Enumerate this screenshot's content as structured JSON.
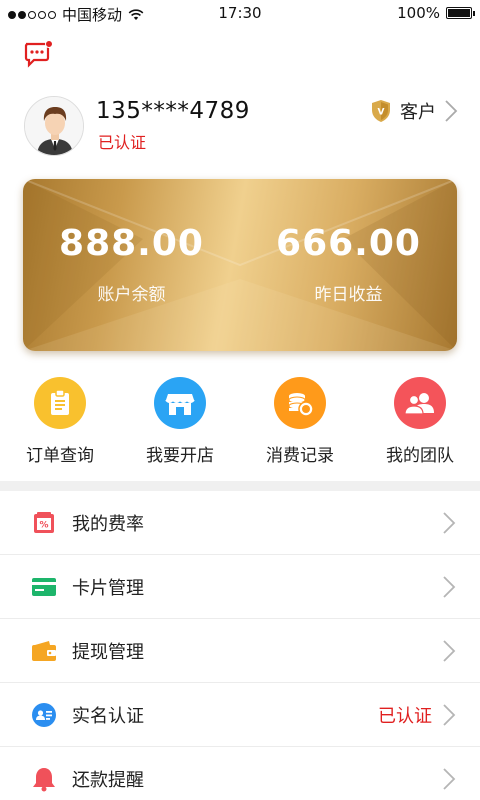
{
  "status_bar": {
    "carrier": "中国移动",
    "time": "17:30",
    "battery": "100%",
    "signal_bars": 2,
    "signal_total": 5
  },
  "profile": {
    "phone": "135****4789",
    "verified": "已认证",
    "customer_label": "客户",
    "badge_letter": "V"
  },
  "card": {
    "balance_value": "888.00",
    "balance_label": "账户余额",
    "yesterday_value": "666.00",
    "yesterday_label": "昨日收益"
  },
  "actions": [
    {
      "label": "订单查询",
      "icon": "order-icon",
      "color": "#f9c12e"
    },
    {
      "label": "我要开店",
      "icon": "shop-icon",
      "color": "#2aa4f4"
    },
    {
      "label": "消费记录",
      "icon": "coins-icon",
      "color": "#ff9a1a"
    },
    {
      "label": "我的团队",
      "icon": "team-icon",
      "color": "#f4545a"
    }
  ],
  "menu": [
    {
      "label": "我的费率",
      "icon": "rate-icon",
      "status": ""
    },
    {
      "label": "卡片管理",
      "icon": "card-icon",
      "status": ""
    },
    {
      "label": "提现管理",
      "icon": "wallet-icon",
      "status": ""
    },
    {
      "label": "实名认证",
      "icon": "id-icon",
      "status": "已认证"
    },
    {
      "label": "还款提醒",
      "icon": "bell-icon",
      "status": ""
    }
  ],
  "colors": {
    "accent_red": "#e02020",
    "gold": "#d9ad62"
  }
}
